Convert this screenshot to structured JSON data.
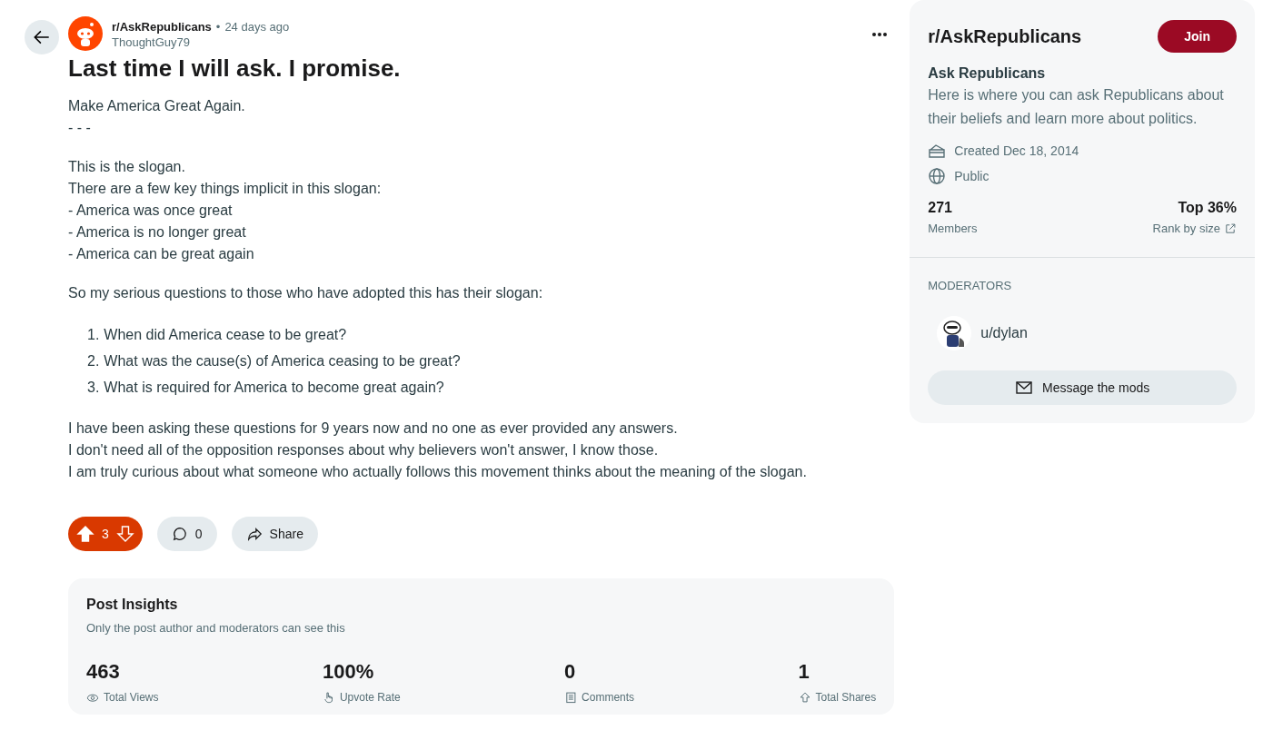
{
  "post": {
    "subreddit": "r/AskRepublicans",
    "separator": "•",
    "time": "24 days ago",
    "author": "ThoughtGuy79",
    "title": "Last time I will ask. I promise.",
    "body": [
      {
        "kind": "lines",
        "lines": [
          "Make America Great Again.",
          "- - -"
        ]
      },
      {
        "kind": "lines",
        "lines": [
          "This is the slogan.",
          "There are a few key things implicit in this slogan:",
          "- America was once great",
          "- America is no longer great",
          "- America can be great again"
        ]
      },
      {
        "kind": "lines",
        "lines": [
          "So my serious questions to those who have adopted this has their slogan:"
        ]
      },
      {
        "kind": "ordered",
        "items": [
          {
            "marker": "1.",
            "text": "When did America cease to be great?"
          },
          {
            "marker": "2.",
            "text": "What was the cause(s) of America ceasing to be great?"
          },
          {
            "marker": "3.",
            "text": "What is required for America to become great again?"
          }
        ]
      },
      {
        "kind": "lines",
        "lines": [
          "I have been asking these questions for 9 years now and no one as ever provided any answers.",
          "I don't need all of the opposition responses about why believers won't answer, I know those.",
          "I am truly curious about what someone who actually follows this movement thinks about the meaning of the slogan."
        ]
      }
    ],
    "vote": {
      "score": "3",
      "upvoted": true
    },
    "comments": "0",
    "share": "Share"
  },
  "insights": {
    "title": "Post Insights",
    "note": "Only the post author and moderators can see this",
    "stats": [
      {
        "kind": "views",
        "value": "463",
        "label": "Total Views"
      },
      {
        "kind": "upvote",
        "value": "100%",
        "label": "Upvote Rate"
      },
      {
        "kind": "comments",
        "value": "0",
        "label": "Comments"
      },
      {
        "kind": "shares",
        "value": "1",
        "label": "Total Shares"
      }
    ]
  },
  "sidebar": {
    "name": "r/AskRepublicans",
    "join": "Join",
    "title": "Ask Republicans",
    "description": "Here is where you can ask Republicans about their beliefs and learn more about politics.",
    "created": "Created Dec 18, 2014",
    "visibility": "Public",
    "members": "271",
    "members_label": "Members",
    "rank": "Top 36%",
    "rank_label": "Rank by size",
    "moderators_heading": "MODERATORS",
    "moderators": [
      "u/dylan"
    ],
    "message": "Message the mods"
  }
}
